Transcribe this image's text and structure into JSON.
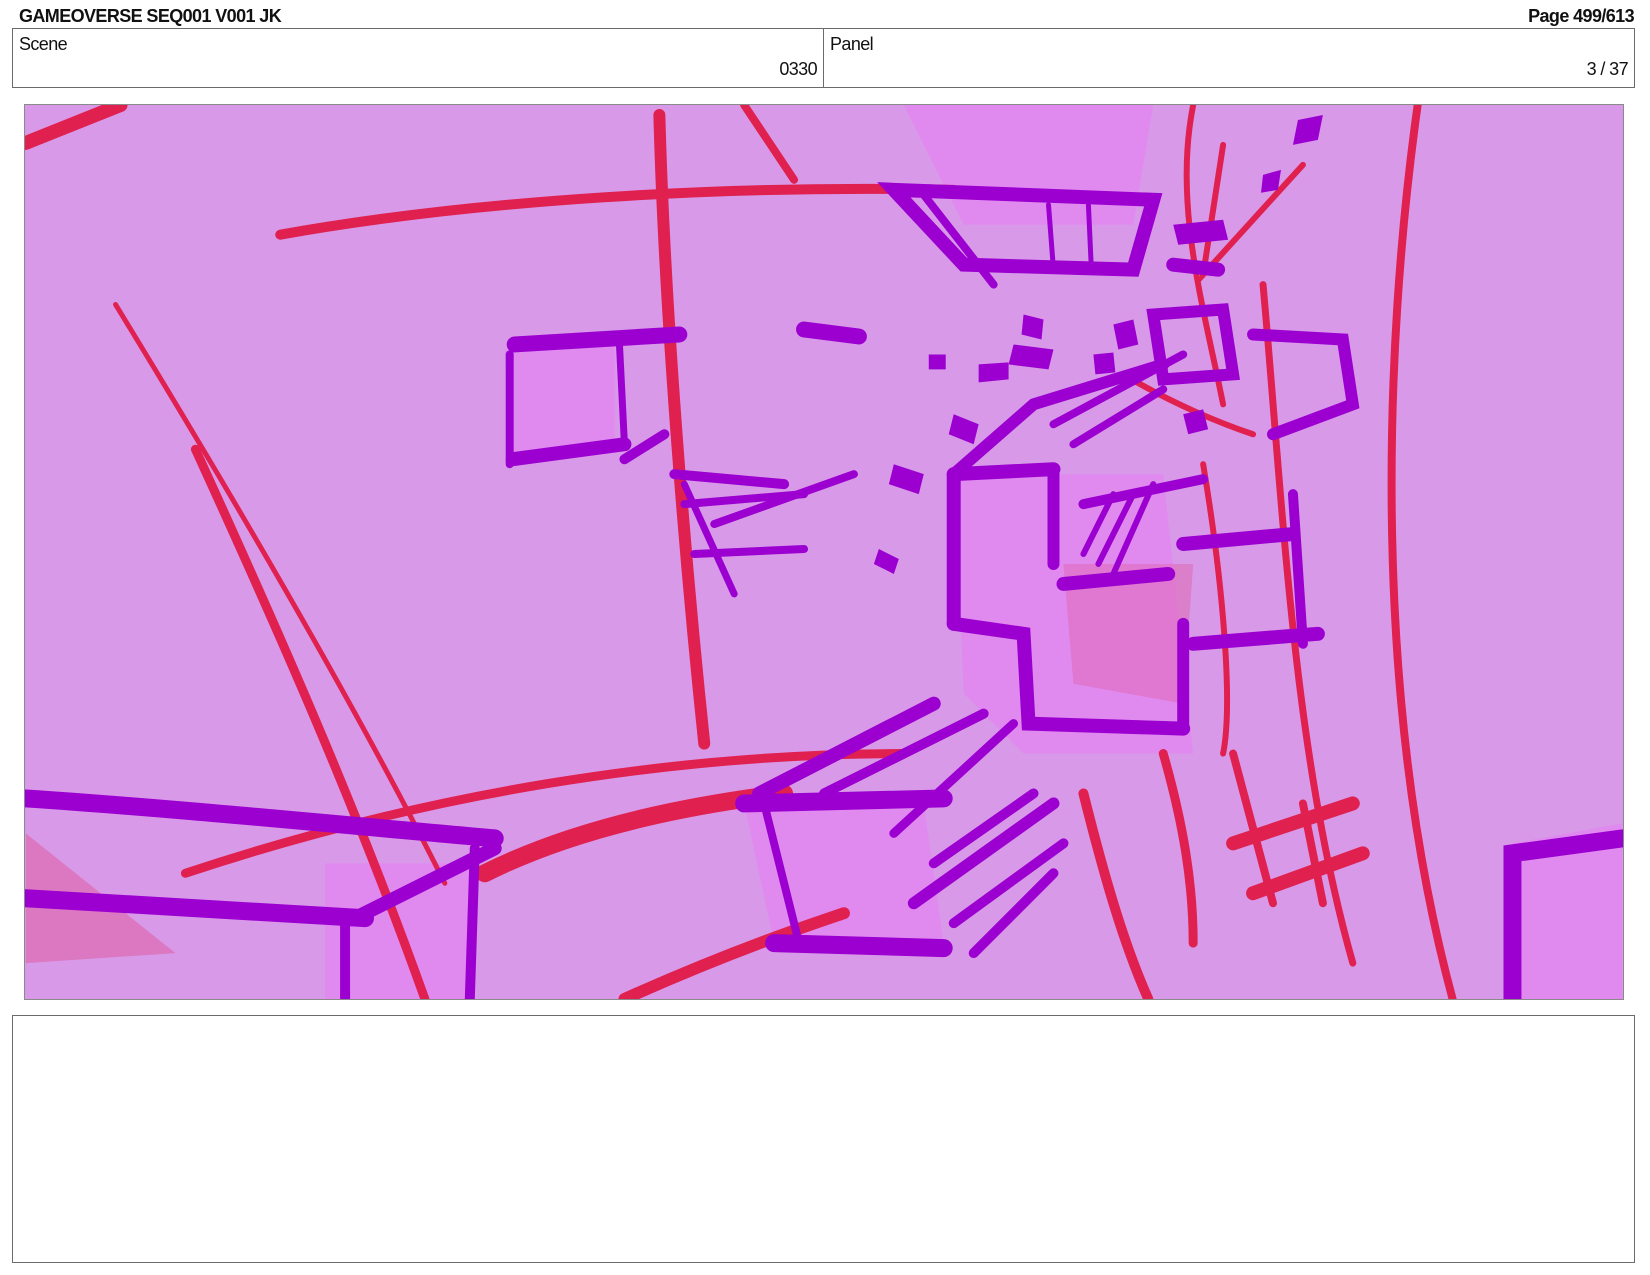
{
  "header": {
    "title": "GAMEOVERSE SEQ001 V001 JK",
    "page": "Page 499/613"
  },
  "scene": {
    "label": "Scene",
    "value": "0330"
  },
  "panel": {
    "label": "Panel",
    "value": "3 / 37"
  },
  "colors": {
    "background": "#d89ae8",
    "red_stroke": "#e0204f",
    "purple_stroke": "#9b00d0",
    "light_face": "#e08af0",
    "pink_face": "#e060a8"
  },
  "notes": {
    "text": ""
  }
}
